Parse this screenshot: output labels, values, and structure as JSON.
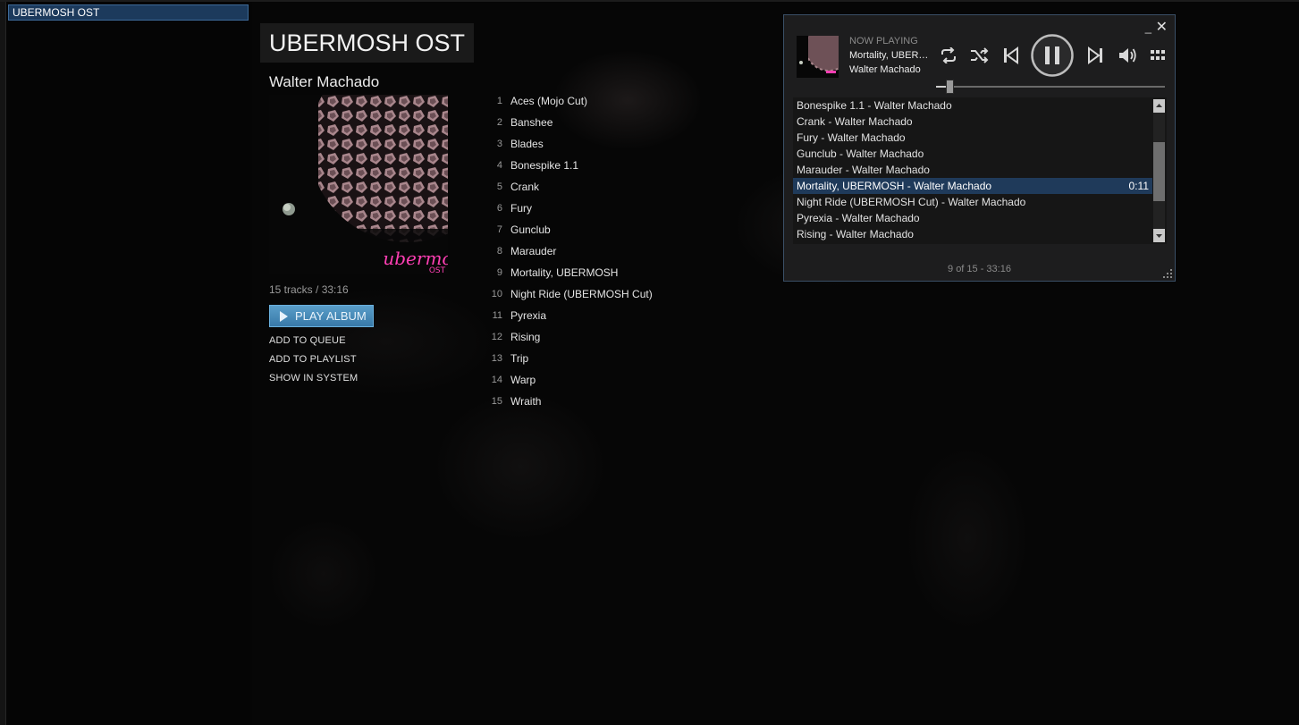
{
  "left_panel": {
    "selected_album": "UBERMOSH OST"
  },
  "album": {
    "title": "UBERMOSH OST",
    "artist": "Walter Machado",
    "art_text": "ubermosh",
    "art_subtext": "OST",
    "meta": "15 tracks / 33:16",
    "play_label": "PLAY ALBUM",
    "add_to_queue": "ADD TO QUEUE",
    "add_to_playlist": "ADD TO PLAYLIST",
    "show_in_system": "SHOW IN SYSTEM",
    "tracks": [
      {
        "num": "1",
        "title": "Aces (Mojo Cut)"
      },
      {
        "num": "2",
        "title": "Banshee"
      },
      {
        "num": "3",
        "title": "Blades"
      },
      {
        "num": "4",
        "title": "Bonespike 1.1"
      },
      {
        "num": "5",
        "title": "Crank"
      },
      {
        "num": "6",
        "title": "Fury"
      },
      {
        "num": "7",
        "title": "Gunclub"
      },
      {
        "num": "8",
        "title": "Marauder"
      },
      {
        "num": "9",
        "title": "Mortality, UBERMOSH"
      },
      {
        "num": "10",
        "title": "Night Ride (UBERMOSH Cut)"
      },
      {
        "num": "11",
        "title": "Pyrexia"
      },
      {
        "num": "12",
        "title": "Rising"
      },
      {
        "num": "13",
        "title": "Trip"
      },
      {
        "num": "14",
        "title": "Warp"
      },
      {
        "num": "15",
        "title": "Wraith"
      }
    ]
  },
  "mini_player": {
    "minimize": "_",
    "close": "✕",
    "now_playing_label": "NOW PLAYING",
    "track": "Mortality, UBERMOSH",
    "artist": "Walter Machado",
    "seek_progress": 0.06,
    "queue": [
      {
        "text": "Bonespike 1.1 - Walter Machado",
        "time": "",
        "active": false
      },
      {
        "text": "Crank - Walter Machado",
        "time": "",
        "active": false
      },
      {
        "text": "Fury - Walter Machado",
        "time": "",
        "active": false
      },
      {
        "text": "Gunclub - Walter Machado",
        "time": "",
        "active": false
      },
      {
        "text": "Marauder - Walter Machado",
        "time": "",
        "active": false
      },
      {
        "text": "Mortality, UBERMOSH - Walter Machado",
        "time": "0:11",
        "active": true
      },
      {
        "text": "Night Ride (UBERMOSH Cut) - Walter Machado",
        "time": "",
        "active": false
      },
      {
        "text": "Pyrexia - Walter Machado",
        "time": "",
        "active": false
      },
      {
        "text": "Rising - Walter Machado",
        "time": "",
        "active": false
      }
    ],
    "footer": "9 of 15 - 33:16",
    "colors": {
      "accent": "#3879a8",
      "selection": "#1f3a5a",
      "art_logo": "#ff3fb4"
    },
    "icons": [
      "repeat-icon",
      "shuffle-icon",
      "previous-icon",
      "pause-icon",
      "next-icon",
      "volume-icon",
      "menu-grid-icon"
    ]
  }
}
